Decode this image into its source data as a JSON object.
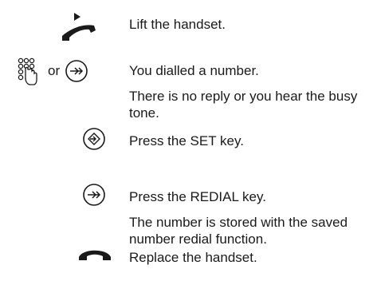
{
  "steps": [
    {
      "icon": "lift-handset-icon",
      "text": "Lift the handset."
    },
    {
      "icon": "keypad-icon",
      "alt_icon": "redial-key-icon",
      "or_label": "or",
      "text": "You dialled a number."
    },
    {
      "text": "There is no reply or you hear the busy tone."
    },
    {
      "icon": "set-key-icon",
      "text": "Press the SET key."
    },
    {
      "icon": "redial-key-icon",
      "text": "Press the REDIAL key."
    },
    {
      "text": "The number is stored with the saved number redial function."
    },
    {
      "icon": "replace-handset-icon",
      "text": "Replace the handset."
    }
  ]
}
